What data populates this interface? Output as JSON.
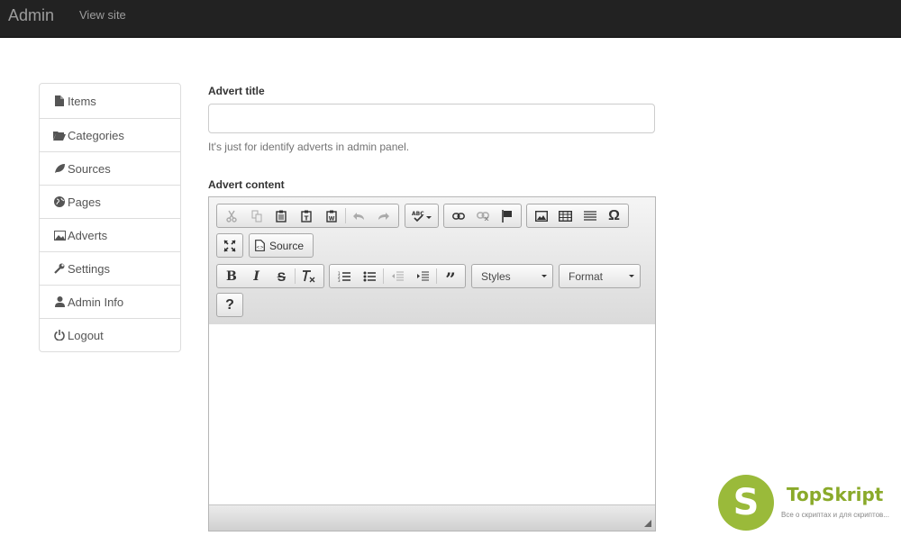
{
  "navbar": {
    "brand": "Admin",
    "view_site": "View site"
  },
  "sidebar": {
    "items": [
      {
        "label": "Items",
        "icon": "file-icon"
      },
      {
        "label": "Categories",
        "icon": "folder-open-icon"
      },
      {
        "label": "Sources",
        "icon": "leaf-icon"
      },
      {
        "label": "Pages",
        "icon": "globe-icon"
      },
      {
        "label": "Adverts",
        "icon": "picture-icon"
      },
      {
        "label": "Settings",
        "icon": "wrench-icon"
      },
      {
        "label": "Admin Info",
        "icon": "user-icon"
      },
      {
        "label": "Logout",
        "icon": "power-icon"
      }
    ]
  },
  "form": {
    "title_label": "Advert title",
    "title_value": "",
    "title_help": "It's just for identify adverts in admin panel.",
    "content_label": "Advert content"
  },
  "editor": {
    "source_label": "Source",
    "styles_label": "Styles",
    "format_label": "Format",
    "help_label": "?"
  },
  "watermark": {
    "name": "TopSkript",
    "tagline": "Все о скриптах и для скриптов...",
    "letter": "S"
  },
  "colors": {
    "navbar_bg": "#222222",
    "watermark_green": "#9aba3a"
  }
}
